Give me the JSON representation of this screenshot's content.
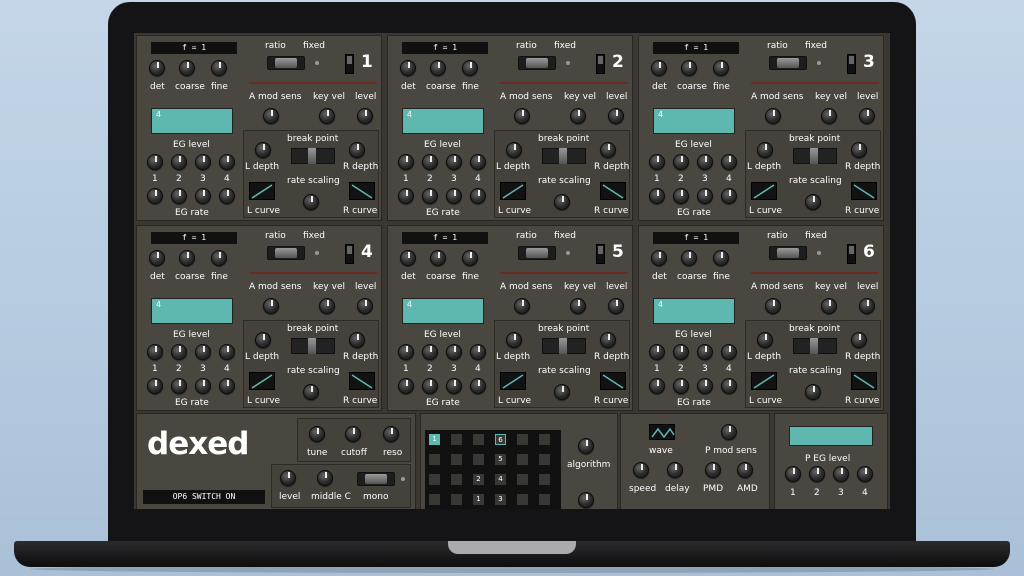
{
  "operator_labels": {
    "freq": "f = 1",
    "ratio": "ratio",
    "fixed": "fixed",
    "det": "det",
    "coarse": "coarse",
    "fine": "fine",
    "a_mod_sens": "A mod sens",
    "key_vel": "key vel",
    "level": "level",
    "eg_level": "EG level",
    "eg_rate": "EG rate",
    "break_point": "break point",
    "l_depth": "L depth",
    "r_depth": "R depth",
    "rate_scaling": "rate scaling",
    "l_curve": "L curve",
    "r_curve": "R curve",
    "n1": "1",
    "n2": "2",
    "n3": "3",
    "n4": "4"
  },
  "operators": [
    {
      "number": "1",
      "eg_display": "4"
    },
    {
      "number": "2",
      "eg_display": "4"
    },
    {
      "number": "3",
      "eg_display": "4"
    },
    {
      "number": "4",
      "eg_display": "4"
    },
    {
      "number": "5",
      "eg_display": "4"
    },
    {
      "number": "6",
      "eg_display": "4"
    }
  ],
  "global": {
    "logo": "dexed",
    "status": "OP6 SWITCH ON",
    "tune": "tune",
    "cutoff": "cutoff",
    "reso": "reso",
    "level": "level",
    "middle_c": "middle C",
    "mono": "mono"
  },
  "algorithm": {
    "label": "algorithm",
    "cells": [
      "1",
      "6",
      "5",
      "4",
      "2",
      "1",
      "3"
    ]
  },
  "lfo": {
    "wave": "wave",
    "p_mod_sens": "P mod sens",
    "speed": "speed",
    "delay": "delay",
    "pmd": "PMD",
    "amd": "AMD"
  },
  "pitch_eg": {
    "label": "P EG level",
    "n1": "1",
    "n2": "2",
    "n3": "3",
    "n4": "4"
  }
}
